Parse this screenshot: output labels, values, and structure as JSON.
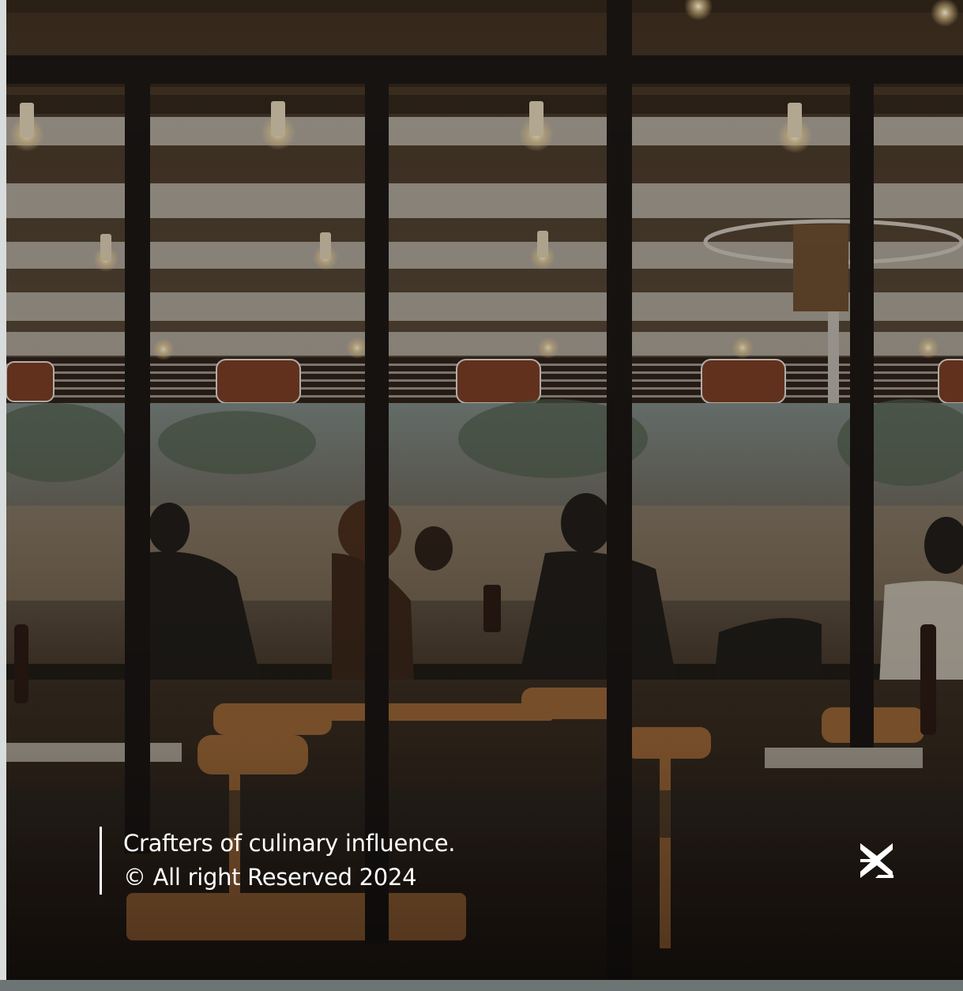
{
  "background": {
    "scene": "restaurant-interior-photo",
    "overlay_color": "#1e1914"
  },
  "footer": {
    "tagline": "Crafters of culinary influence.",
    "copyright": "© All right Reserved 2024"
  },
  "logo": {
    "icon": "brand-logo-icon",
    "color": "#ffffff"
  }
}
